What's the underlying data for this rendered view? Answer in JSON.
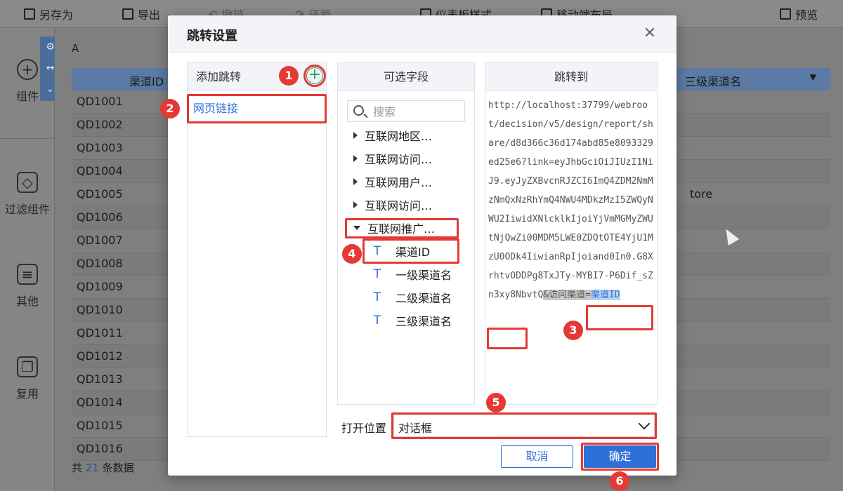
{
  "toolbar": {
    "save_as": "另存为",
    "export": "导出",
    "undo": "撤销",
    "redo": "还原",
    "dashboard_style": "仪表板样式",
    "mobile_layout": "移动端布局",
    "preview": "预览"
  },
  "leftbar": {
    "components": "组件",
    "filter_components": "过滤组件",
    "others": "其他",
    "reuse": "复用"
  },
  "canvas": {
    "widget_title": "A",
    "columns": [
      "渠道ID",
      "三级渠道名"
    ],
    "rows": [
      "QD1001",
      "QD1002",
      "QD1003",
      "QD1004",
      "QD1005",
      "QD1006",
      "QD1007",
      "QD1008",
      "QD1009",
      "QD1010",
      "QD1011",
      "QD1012",
      "QD1013",
      "QD1014",
      "QD1015",
      "QD1016"
    ],
    "store_fragment": "tore",
    "footer_prefix": "共",
    "footer_count": "21",
    "footer_suffix": "条数据"
  },
  "dialog": {
    "title": "跳转设置",
    "add_jump_header": "添加跳转",
    "jump_items": [
      "网页链接"
    ],
    "fields_header": "可选字段",
    "search_placeholder": "搜索",
    "field_groups": [
      "互联网地区…",
      "互联网访问…",
      "互联网用户…",
      "互联网访问…",
      "互联网推广…"
    ],
    "fields": [
      "渠道ID",
      "一级渠道名",
      "二级渠道名",
      "三级渠道名"
    ],
    "jump_to_header": "跳转到",
    "url": "http://localhost:37799/webroot/decision/v5/design/report/share/d8d366c36d174abd85e8093329ed25e6?link=eyJhbGciOiJIUzI1NiJ9.eyJyZXBvcnRJZCI6ImQ4ZDM2NmMzNmQxNzRhYmQ4NWU4MDkzMzI5ZWQyNWU2IiwidXNlcklkIjoiYjVmMGMyZWUtNjQwZi00MDM5LWE0ZDQtOTE4YjU1MzU0ODk4IiwianRpIjoiand0In0.G8XrhtvODDPg8TxJTy-MYBI7-P6Dif_sZn3xy8NbvtQ",
    "url_param": "&访问渠道=",
    "url_field": "渠道ID",
    "open_position_label": "打开位置",
    "open_position_value": "对话框",
    "cancel": "取消",
    "ok": "确定"
  },
  "annotations": [
    "1",
    "2",
    "3",
    "4",
    "5",
    "6"
  ],
  "colors": {
    "accent": "#2e6fd8",
    "annotation_red": "#e53935",
    "add_green": "#23a354"
  }
}
